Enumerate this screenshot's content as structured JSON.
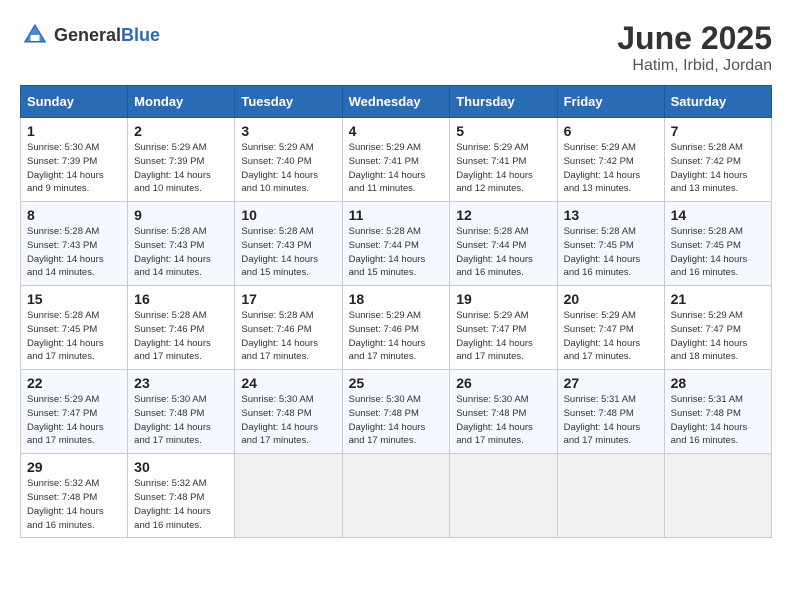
{
  "header": {
    "logo_general": "General",
    "logo_blue": "Blue",
    "month_title": "June 2025",
    "location": "Hatim, Irbid, Jordan"
  },
  "weekdays": [
    "Sunday",
    "Monday",
    "Tuesday",
    "Wednesday",
    "Thursday",
    "Friday",
    "Saturday"
  ],
  "weeks": [
    [
      {
        "day": "1",
        "sunrise": "5:30 AM",
        "sunset": "7:39 PM",
        "daylight": "14 hours and 9 minutes."
      },
      {
        "day": "2",
        "sunrise": "5:29 AM",
        "sunset": "7:39 PM",
        "daylight": "14 hours and 10 minutes."
      },
      {
        "day": "3",
        "sunrise": "5:29 AM",
        "sunset": "7:40 PM",
        "daylight": "14 hours and 10 minutes."
      },
      {
        "day": "4",
        "sunrise": "5:29 AM",
        "sunset": "7:41 PM",
        "daylight": "14 hours and 11 minutes."
      },
      {
        "day": "5",
        "sunrise": "5:29 AM",
        "sunset": "7:41 PM",
        "daylight": "14 hours and 12 minutes."
      },
      {
        "day": "6",
        "sunrise": "5:29 AM",
        "sunset": "7:42 PM",
        "daylight": "14 hours and 13 minutes."
      },
      {
        "day": "7",
        "sunrise": "5:28 AM",
        "sunset": "7:42 PM",
        "daylight": "14 hours and 13 minutes."
      }
    ],
    [
      {
        "day": "8",
        "sunrise": "5:28 AM",
        "sunset": "7:43 PM",
        "daylight": "14 hours and 14 minutes."
      },
      {
        "day": "9",
        "sunrise": "5:28 AM",
        "sunset": "7:43 PM",
        "daylight": "14 hours and 14 minutes."
      },
      {
        "day": "10",
        "sunrise": "5:28 AM",
        "sunset": "7:43 PM",
        "daylight": "14 hours and 15 minutes."
      },
      {
        "day": "11",
        "sunrise": "5:28 AM",
        "sunset": "7:44 PM",
        "daylight": "14 hours and 15 minutes."
      },
      {
        "day": "12",
        "sunrise": "5:28 AM",
        "sunset": "7:44 PM",
        "daylight": "14 hours and 16 minutes."
      },
      {
        "day": "13",
        "sunrise": "5:28 AM",
        "sunset": "7:45 PM",
        "daylight": "14 hours and 16 minutes."
      },
      {
        "day": "14",
        "sunrise": "5:28 AM",
        "sunset": "7:45 PM",
        "daylight": "14 hours and 16 minutes."
      }
    ],
    [
      {
        "day": "15",
        "sunrise": "5:28 AM",
        "sunset": "7:45 PM",
        "daylight": "14 hours and 17 minutes."
      },
      {
        "day": "16",
        "sunrise": "5:28 AM",
        "sunset": "7:46 PM",
        "daylight": "14 hours and 17 minutes."
      },
      {
        "day": "17",
        "sunrise": "5:28 AM",
        "sunset": "7:46 PM",
        "daylight": "14 hours and 17 minutes."
      },
      {
        "day": "18",
        "sunrise": "5:29 AM",
        "sunset": "7:46 PM",
        "daylight": "14 hours and 17 minutes."
      },
      {
        "day": "19",
        "sunrise": "5:29 AM",
        "sunset": "7:47 PM",
        "daylight": "14 hours and 17 minutes."
      },
      {
        "day": "20",
        "sunrise": "5:29 AM",
        "sunset": "7:47 PM",
        "daylight": "14 hours and 17 minutes."
      },
      {
        "day": "21",
        "sunrise": "5:29 AM",
        "sunset": "7:47 PM",
        "daylight": "14 hours and 18 minutes."
      }
    ],
    [
      {
        "day": "22",
        "sunrise": "5:29 AM",
        "sunset": "7:47 PM",
        "daylight": "14 hours and 17 minutes."
      },
      {
        "day": "23",
        "sunrise": "5:30 AM",
        "sunset": "7:48 PM",
        "daylight": "14 hours and 17 minutes."
      },
      {
        "day": "24",
        "sunrise": "5:30 AM",
        "sunset": "7:48 PM",
        "daylight": "14 hours and 17 minutes."
      },
      {
        "day": "25",
        "sunrise": "5:30 AM",
        "sunset": "7:48 PM",
        "daylight": "14 hours and 17 minutes."
      },
      {
        "day": "26",
        "sunrise": "5:30 AM",
        "sunset": "7:48 PM",
        "daylight": "14 hours and 17 minutes."
      },
      {
        "day": "27",
        "sunrise": "5:31 AM",
        "sunset": "7:48 PM",
        "daylight": "14 hours and 17 minutes."
      },
      {
        "day": "28",
        "sunrise": "5:31 AM",
        "sunset": "7:48 PM",
        "daylight": "14 hours and 16 minutes."
      }
    ],
    [
      {
        "day": "29",
        "sunrise": "5:32 AM",
        "sunset": "7:48 PM",
        "daylight": "14 hours and 16 minutes."
      },
      {
        "day": "30",
        "sunrise": "5:32 AM",
        "sunset": "7:48 PM",
        "daylight": "14 hours and 16 minutes."
      },
      null,
      null,
      null,
      null,
      null
    ]
  ]
}
